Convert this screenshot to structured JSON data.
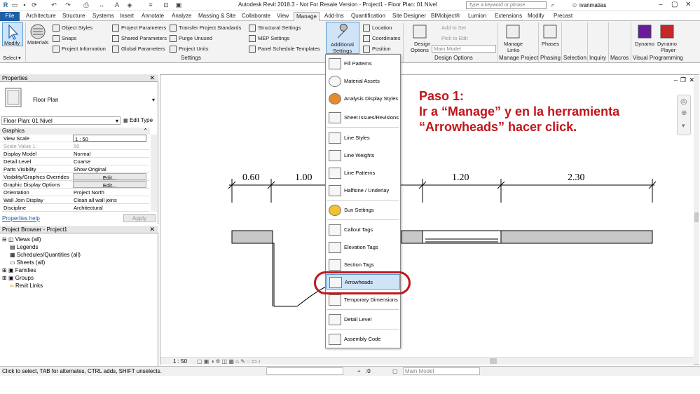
{
  "title_bar": {
    "title": "Autodesk Revit 2018.3 - Not For Resale Version -   Project1 - Floor Plan: 01 Nivel",
    "search_placeholder": "Type a keyword or phrase",
    "user": "ivanmatias"
  },
  "tabs": [
    "File",
    "Architecture",
    "Structure",
    "Systems",
    "Insert",
    "Annotate",
    "Analyze",
    "Massing & Site",
    "Collaborate",
    "View",
    "Manage",
    "Add-Ins",
    "Quantification",
    "Site Designer",
    "BIMobject®",
    "Lumion",
    "Extensions",
    "Modify",
    "Precast"
  ],
  "ribbon": {
    "modify": "Modify",
    "select": "Select",
    "materials": "Materials",
    "object_styles": "Object  Styles",
    "snaps": "Snaps",
    "project_information": "Project  Information",
    "project_parameters": "Project  Parameters",
    "shared_parameters": "Shared  Parameters",
    "global_parameters": "Global  Parameters",
    "transfer_standards": "Transfer  Project Standards",
    "purge_unused": "Purge  Unused",
    "project_units": "Project  Units",
    "structural_settings": "Structural  Settings",
    "mep_settings": "MEP  Settings",
    "panel_schedule_templates": "Panel Schedule  Templates",
    "settings_panel": "Settings",
    "additional_settings_1": "Additional",
    "additional_settings_2": "Settings",
    "location": "Location",
    "coordinates": "Coordinates",
    "position": "Position",
    "design_options_1": "Design",
    "design_options_2": "Options",
    "add_to_set": "Add to Set",
    "pick_to_edit": "Pick to Edit",
    "main_model": "Main Model",
    "design_options_panel": "Design Options",
    "manage_links_1": "Manage",
    "manage_links_2": "Links",
    "manage_project_panel": "Manage Project",
    "phases": "Phases",
    "phasing_panel": "Phasing",
    "selection_panel": "Selection",
    "inquiry_panel": "Inquiry",
    "macros_panel": "Macros",
    "dynamo": "Dynamo",
    "dynamo_player_1": "Dynamo",
    "dynamo_player_2": "Player",
    "visual_programming_panel": "Visual Programming"
  },
  "properties": {
    "header": "Properties",
    "type": "Floor Plan",
    "selector": "Floor Plan: 01 Nivel",
    "edit_type": "Edit Type",
    "group": "Graphics",
    "rows": [
      {
        "k": "View Scale",
        "v": "1 : 50"
      },
      {
        "k": "Scale Value    1:",
        "v": "50"
      },
      {
        "k": "Display Model",
        "v": "Normal"
      },
      {
        "k": "Detail Level",
        "v": "Coarse"
      },
      {
        "k": "Parts Visibility",
        "v": "Show Original"
      },
      {
        "k": "Visibility/Graphics Overrides",
        "v": "Edit..."
      },
      {
        "k": "Graphic Display Options",
        "v": "Edit..."
      },
      {
        "k": "Orientation",
        "v": "Project North"
      },
      {
        "k": "Wall Join Display",
        "v": "Clean all wall joins"
      },
      {
        "k": "Discipline",
        "v": "Architectural"
      }
    ],
    "help": "Properties help",
    "apply": "Apply"
  },
  "browser": {
    "header": "Project Browser - Project1",
    "items": [
      "Views (all)",
      "Legends",
      "Schedules/Quantities (all)",
      "Sheets (all)",
      "Families",
      "Groups",
      "Revit Links"
    ]
  },
  "canvas": {
    "dims": [
      "0.60",
      "1.00",
      "1.20",
      "2.30"
    ],
    "scale": "1 : 50"
  },
  "dropdown": [
    "Fill Patterns",
    "Material Assets",
    "Analysis Display Styles",
    "Sheet Issues/Revisions",
    "Line Styles",
    "Line Weights",
    "Line Patterns",
    "Halftone / Underlay",
    "Sun Settings",
    "Callout Tags",
    "Elevation Tags",
    "Section Tags",
    "Arrowheads",
    "Temporary Dimensions",
    "Detail Level",
    "Assembly Code"
  ],
  "annotation": {
    "line1": "Paso 1:",
    "line2": "Ir a “Manage” y en la herramienta",
    "line3": "“Arrowheads” hacer click."
  },
  "status": {
    "text": "Click to select, TAB for alternates, CTRL adds, SHIFT unselects.",
    "zero": ":0",
    "model": "Main Model"
  },
  "accent_color": "#1f5fa5",
  "highlight_color": "#c0161b"
}
